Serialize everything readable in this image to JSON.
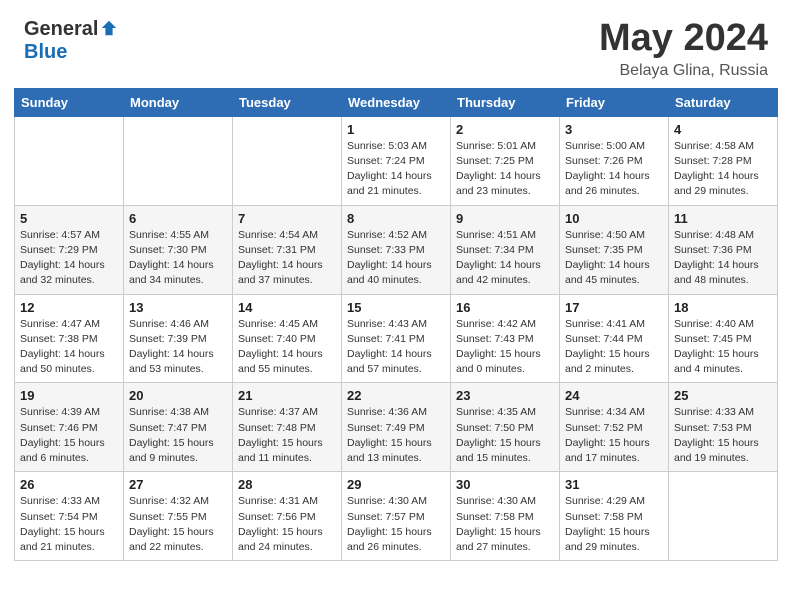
{
  "header": {
    "logo_general": "General",
    "logo_blue": "Blue",
    "month_title": "May 2024",
    "location": "Belaya Glina, Russia"
  },
  "weekdays": [
    "Sunday",
    "Monday",
    "Tuesday",
    "Wednesday",
    "Thursday",
    "Friday",
    "Saturday"
  ],
  "weeks": [
    [
      {
        "day": "",
        "sunrise": "",
        "sunset": "",
        "daylight": ""
      },
      {
        "day": "",
        "sunrise": "",
        "sunset": "",
        "daylight": ""
      },
      {
        "day": "",
        "sunrise": "",
        "sunset": "",
        "daylight": ""
      },
      {
        "day": "1",
        "sunrise": "Sunrise: 5:03 AM",
        "sunset": "Sunset: 7:24 PM",
        "daylight": "Daylight: 14 hours and 21 minutes."
      },
      {
        "day": "2",
        "sunrise": "Sunrise: 5:01 AM",
        "sunset": "Sunset: 7:25 PM",
        "daylight": "Daylight: 14 hours and 23 minutes."
      },
      {
        "day": "3",
        "sunrise": "Sunrise: 5:00 AM",
        "sunset": "Sunset: 7:26 PM",
        "daylight": "Daylight: 14 hours and 26 minutes."
      },
      {
        "day": "4",
        "sunrise": "Sunrise: 4:58 AM",
        "sunset": "Sunset: 7:28 PM",
        "daylight": "Daylight: 14 hours and 29 minutes."
      }
    ],
    [
      {
        "day": "5",
        "sunrise": "Sunrise: 4:57 AM",
        "sunset": "Sunset: 7:29 PM",
        "daylight": "Daylight: 14 hours and 32 minutes."
      },
      {
        "day": "6",
        "sunrise": "Sunrise: 4:55 AM",
        "sunset": "Sunset: 7:30 PM",
        "daylight": "Daylight: 14 hours and 34 minutes."
      },
      {
        "day": "7",
        "sunrise": "Sunrise: 4:54 AM",
        "sunset": "Sunset: 7:31 PM",
        "daylight": "Daylight: 14 hours and 37 minutes."
      },
      {
        "day": "8",
        "sunrise": "Sunrise: 4:52 AM",
        "sunset": "Sunset: 7:33 PM",
        "daylight": "Daylight: 14 hours and 40 minutes."
      },
      {
        "day": "9",
        "sunrise": "Sunrise: 4:51 AM",
        "sunset": "Sunset: 7:34 PM",
        "daylight": "Daylight: 14 hours and 42 minutes."
      },
      {
        "day": "10",
        "sunrise": "Sunrise: 4:50 AM",
        "sunset": "Sunset: 7:35 PM",
        "daylight": "Daylight: 14 hours and 45 minutes."
      },
      {
        "day": "11",
        "sunrise": "Sunrise: 4:48 AM",
        "sunset": "Sunset: 7:36 PM",
        "daylight": "Daylight: 14 hours and 48 minutes."
      }
    ],
    [
      {
        "day": "12",
        "sunrise": "Sunrise: 4:47 AM",
        "sunset": "Sunset: 7:38 PM",
        "daylight": "Daylight: 14 hours and 50 minutes."
      },
      {
        "day": "13",
        "sunrise": "Sunrise: 4:46 AM",
        "sunset": "Sunset: 7:39 PM",
        "daylight": "Daylight: 14 hours and 53 minutes."
      },
      {
        "day": "14",
        "sunrise": "Sunrise: 4:45 AM",
        "sunset": "Sunset: 7:40 PM",
        "daylight": "Daylight: 14 hours and 55 minutes."
      },
      {
        "day": "15",
        "sunrise": "Sunrise: 4:43 AM",
        "sunset": "Sunset: 7:41 PM",
        "daylight": "Daylight: 14 hours and 57 minutes."
      },
      {
        "day": "16",
        "sunrise": "Sunrise: 4:42 AM",
        "sunset": "Sunset: 7:43 PM",
        "daylight": "Daylight: 15 hours and 0 minutes."
      },
      {
        "day": "17",
        "sunrise": "Sunrise: 4:41 AM",
        "sunset": "Sunset: 7:44 PM",
        "daylight": "Daylight: 15 hours and 2 minutes."
      },
      {
        "day": "18",
        "sunrise": "Sunrise: 4:40 AM",
        "sunset": "Sunset: 7:45 PM",
        "daylight": "Daylight: 15 hours and 4 minutes."
      }
    ],
    [
      {
        "day": "19",
        "sunrise": "Sunrise: 4:39 AM",
        "sunset": "Sunset: 7:46 PM",
        "daylight": "Daylight: 15 hours and 6 minutes."
      },
      {
        "day": "20",
        "sunrise": "Sunrise: 4:38 AM",
        "sunset": "Sunset: 7:47 PM",
        "daylight": "Daylight: 15 hours and 9 minutes."
      },
      {
        "day": "21",
        "sunrise": "Sunrise: 4:37 AM",
        "sunset": "Sunset: 7:48 PM",
        "daylight": "Daylight: 15 hours and 11 minutes."
      },
      {
        "day": "22",
        "sunrise": "Sunrise: 4:36 AM",
        "sunset": "Sunset: 7:49 PM",
        "daylight": "Daylight: 15 hours and 13 minutes."
      },
      {
        "day": "23",
        "sunrise": "Sunrise: 4:35 AM",
        "sunset": "Sunset: 7:50 PM",
        "daylight": "Daylight: 15 hours and 15 minutes."
      },
      {
        "day": "24",
        "sunrise": "Sunrise: 4:34 AM",
        "sunset": "Sunset: 7:52 PM",
        "daylight": "Daylight: 15 hours and 17 minutes."
      },
      {
        "day": "25",
        "sunrise": "Sunrise: 4:33 AM",
        "sunset": "Sunset: 7:53 PM",
        "daylight": "Daylight: 15 hours and 19 minutes."
      }
    ],
    [
      {
        "day": "26",
        "sunrise": "Sunrise: 4:33 AM",
        "sunset": "Sunset: 7:54 PM",
        "daylight": "Daylight: 15 hours and 21 minutes."
      },
      {
        "day": "27",
        "sunrise": "Sunrise: 4:32 AM",
        "sunset": "Sunset: 7:55 PM",
        "daylight": "Daylight: 15 hours and 22 minutes."
      },
      {
        "day": "28",
        "sunrise": "Sunrise: 4:31 AM",
        "sunset": "Sunset: 7:56 PM",
        "daylight": "Daylight: 15 hours and 24 minutes."
      },
      {
        "day": "29",
        "sunrise": "Sunrise: 4:30 AM",
        "sunset": "Sunset: 7:57 PM",
        "daylight": "Daylight: 15 hours and 26 minutes."
      },
      {
        "day": "30",
        "sunrise": "Sunrise: 4:30 AM",
        "sunset": "Sunset: 7:58 PM",
        "daylight": "Daylight: 15 hours and 27 minutes."
      },
      {
        "day": "31",
        "sunrise": "Sunrise: 4:29 AM",
        "sunset": "Sunset: 7:58 PM",
        "daylight": "Daylight: 15 hours and 29 minutes."
      },
      {
        "day": "",
        "sunrise": "",
        "sunset": "",
        "daylight": ""
      }
    ]
  ]
}
